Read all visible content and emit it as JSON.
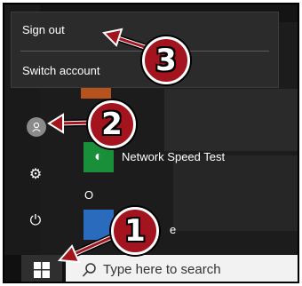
{
  "menu": {
    "sign_out": "Sign out",
    "switch_account": "Switch account"
  },
  "tiles": {
    "network_speed_test": "Network Speed Test",
    "letter_o": "O",
    "partial_label": "e"
  },
  "taskbar": {
    "search_placeholder": "Type here to search"
  },
  "callouts": [
    "1",
    "2",
    "3"
  ],
  "icons": {
    "start": "windows-logo-icon",
    "search": "search-icon",
    "settings": "gear-icon",
    "power": "power-icon",
    "user": "user-avatar-icon"
  },
  "colors": {
    "callout_fill": "#a3141e",
    "menu_bg": "#2b2b2b",
    "taskbar_bg": "#101010",
    "search_bg": "#f2f2f2"
  }
}
